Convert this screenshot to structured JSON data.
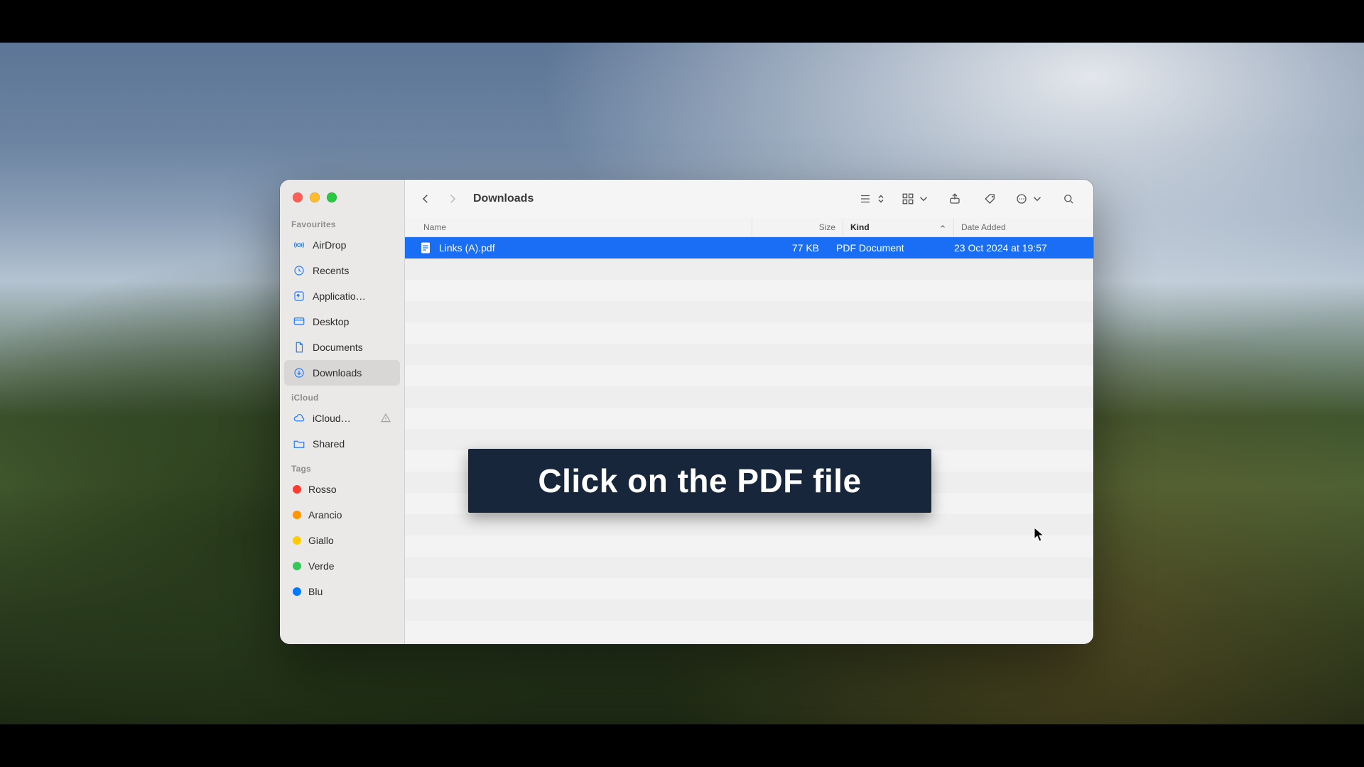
{
  "window": {
    "title": "Downloads"
  },
  "sidebar": {
    "sections": {
      "favourites_label": "Favourites",
      "icloud_label": "iCloud",
      "tags_label": "Tags"
    },
    "favourites": [
      {
        "label": "AirDrop"
      },
      {
        "label": "Recents"
      },
      {
        "label": "Applicatio…"
      },
      {
        "label": "Desktop"
      },
      {
        "label": "Documents"
      },
      {
        "label": "Downloads"
      }
    ],
    "icloud": [
      {
        "label": "iCloud…"
      },
      {
        "label": "Shared"
      }
    ],
    "tags": [
      {
        "label": "Rosso",
        "color": "#ff3b30"
      },
      {
        "label": "Arancio",
        "color": "#ff9500"
      },
      {
        "label": "Giallo",
        "color": "#ffcc00"
      },
      {
        "label": "Verde",
        "color": "#34c759"
      },
      {
        "label": "Blu",
        "color": "#007aff"
      }
    ]
  },
  "columns": {
    "name": "Name",
    "size": "Size",
    "kind": "Kind",
    "date": "Date Added"
  },
  "files": [
    {
      "name": "Links (A).pdf",
      "size": "77 KB",
      "kind": "PDF Document",
      "date": "23 Oct 2024 at 19:57",
      "selected": true
    }
  ],
  "caption": "Click on the PDF file",
  "colors": {
    "selection": "#1a6ef5",
    "sidebar_icon": "#1d7bff",
    "caption_bg": "#17263a"
  }
}
